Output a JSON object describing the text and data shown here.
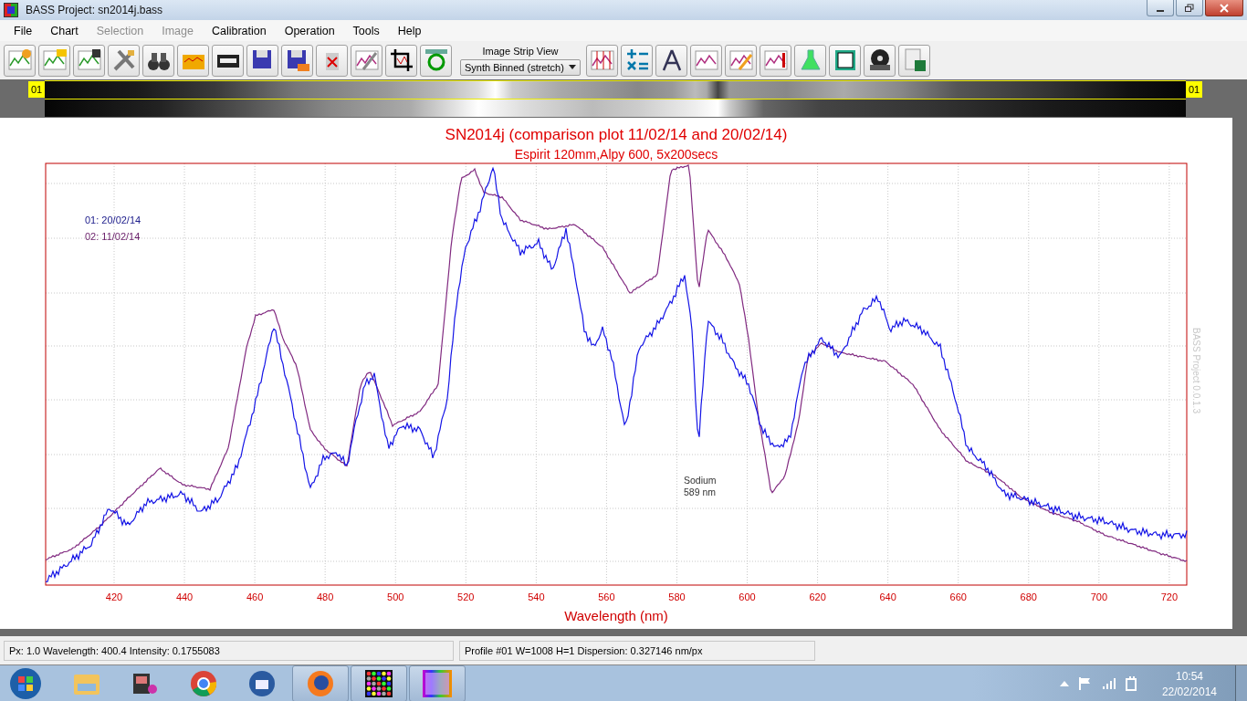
{
  "window": {
    "title": "BASS Project: sn2014j.bass"
  },
  "menu": [
    {
      "label": "File",
      "disabled": false
    },
    {
      "label": "Chart",
      "disabled": false
    },
    {
      "label": "Selection",
      "disabled": true
    },
    {
      "label": "Image",
      "disabled": true
    },
    {
      "label": "Calibration",
      "disabled": false
    },
    {
      "label": "Operation",
      "disabled": false
    },
    {
      "label": "Tools",
      "disabled": false
    },
    {
      "label": "Help",
      "disabled": false
    }
  ],
  "toolbar": {
    "strip_view_label": "Image Strip View",
    "strip_view_value": "Synth Binned (stretch)"
  },
  "image_strip": {
    "left_label": "01",
    "right_label": "01"
  },
  "chart": {
    "title": "SN2014j (comparison plot 11/02/14 and 20/02/14)",
    "subtitle": "Espirit 120mm,Alpy 600, 5x200secs",
    "xlabel": "Wavelength (nm)",
    "xticks": [
      "420",
      "440",
      "460",
      "480",
      "500",
      "520",
      "540",
      "560",
      "580",
      "600",
      "620",
      "640",
      "660",
      "680",
      "700",
      "720"
    ],
    "legend": [
      {
        "label": "01: 20/02/14",
        "color": "#1a1a8a"
      },
      {
        "label": "02: 11/02/14",
        "color": "#6a1f6a"
      }
    ],
    "annotation": [
      "Sodium",
      "589 nm"
    ],
    "version_mark": "BASS Project 0.0.1.3"
  },
  "status_bar": [
    "Px: 1.0  Wavelength: 400.4  Intensity:  0.1755083",
    "Profile #01 W=1008 H=1  Dispersion: 0.327146 nm/px"
  ],
  "taskbar": {
    "time": "10:54",
    "date": "22/02/2014"
  }
}
